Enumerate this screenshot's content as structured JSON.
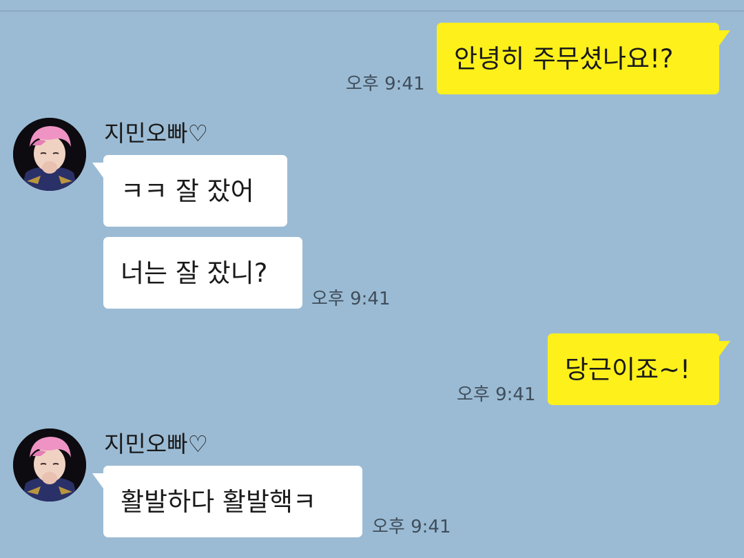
{
  "chat": {
    "messages": [
      {
        "sender": "me",
        "text": "안녕히 주무셨나요!?",
        "time": "오후 9:41"
      },
      {
        "sender": "지민오빠♡",
        "text": "ㅋㅋ 잘 잤어"
      },
      {
        "sender": "지민오빠♡",
        "text": "너는 잘 잤니?",
        "time": "오후 9:41"
      },
      {
        "sender": "me",
        "text": "당근이죠~!",
        "time": "오후 9:41"
      },
      {
        "sender": "지민오빠♡",
        "text": "활발하다 활발핵ㅋ",
        "time": "오후 9:41"
      }
    ],
    "contact": {
      "name": "지민오빠♡",
      "avatar_icon": "profile-photo"
    }
  },
  "colors": {
    "background": "#9bbbd4",
    "my_bubble": "#fef01b",
    "their_bubble": "#ffffff"
  }
}
